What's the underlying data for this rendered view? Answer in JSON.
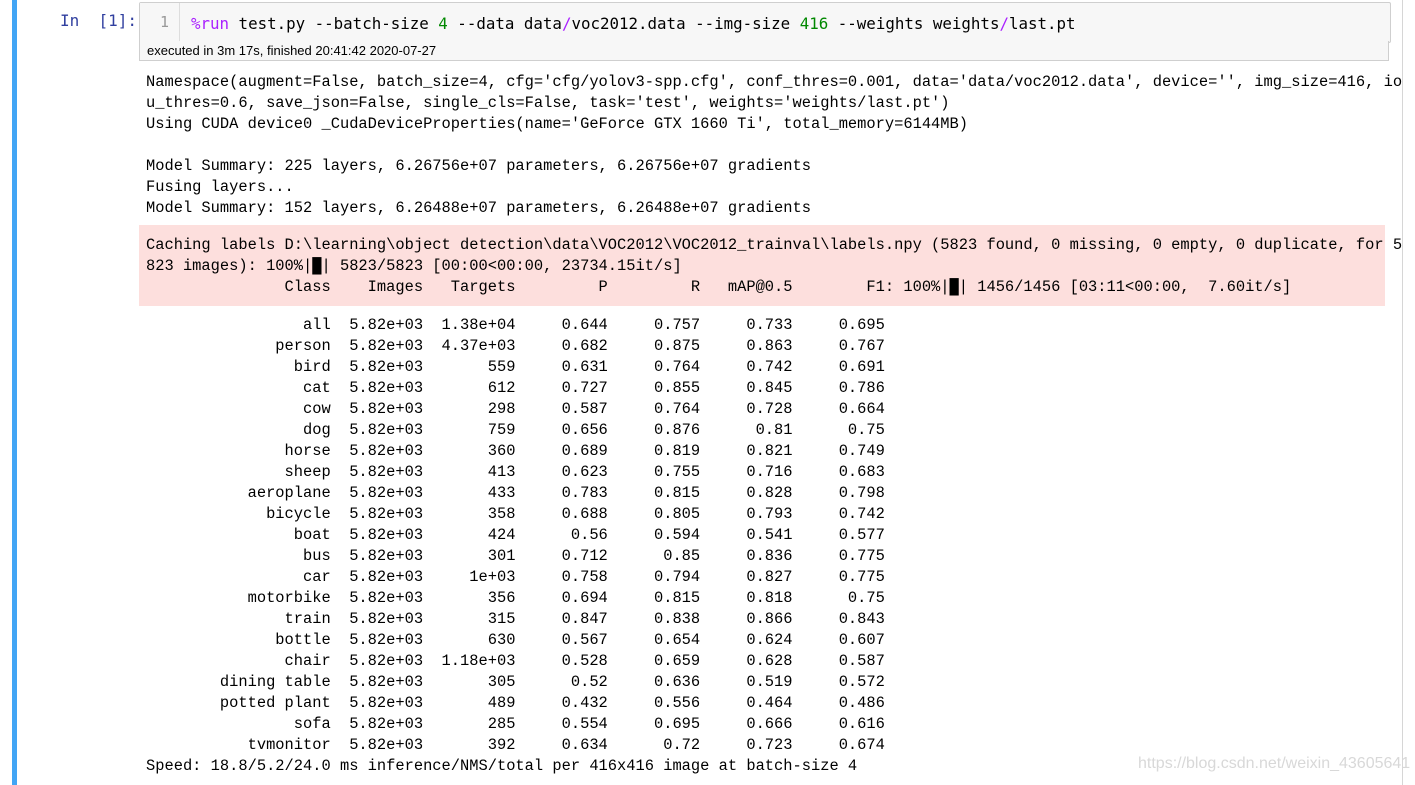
{
  "cell": {
    "prompt": "In  [1]:",
    "line_number": "1",
    "code": {
      "magic": "%run",
      "part1": " test.py --batch-size ",
      "batch": "4",
      "part2": " --data data",
      "slash1": "/",
      "part3": "voc2012.data --img-size ",
      "img": "416",
      "part4": " --weights weights",
      "slash2": "/",
      "part5": "last.pt"
    },
    "execution_info": "executed in 3m 17s, finished 20:41:42 2020-07-27"
  },
  "output": {
    "stdout_top": "Namespace(augment=False, batch_size=4, cfg='cfg/yolov3-spp.cfg', conf_thres=0.001, data='data/voc2012.data', device='', img_size=416, io\nu_thres=0.6, save_json=False, single_cls=False, task='test', weights='weights/last.pt')\nUsing CUDA device0 _CudaDeviceProperties(name='GeForce GTX 1660 Ti', total_memory=6144MB)\n\nModel Summary: 225 layers, 6.26756e+07 parameters, 6.26756e+07 gradients\nFusing layers...\nModel Summary: 152 layers, 6.26488e+07 parameters, 6.26488e+07 gradients",
    "stderr": "Caching labels D:\\learning\\object detection\\data\\VOC2012\\VOC2012_trainval\\labels.npy (5823 found, 0 missing, 0 empty, 0 duplicate, for 5\n823 images): 100%|█| 5823/5823 [00:00<00:00, 23734.15it/s]\n               Class    Images   Targets         P         R   mAP@0.5        F1: 100%|█| 1456/1456 [03:11<00:00,  7.60it/s]",
    "results_table": "                 all  5.82e+03  1.38e+04     0.644     0.757     0.733     0.695\n              person  5.82e+03  4.37e+03     0.682     0.875     0.863     0.767\n                bird  5.82e+03       559     0.631     0.764     0.742     0.691\n                 cat  5.82e+03       612     0.727     0.855     0.845     0.786\n                 cow  5.82e+03       298     0.587     0.764     0.728     0.664\n                 dog  5.82e+03       759     0.656     0.876      0.81      0.75\n               horse  5.82e+03       360     0.689     0.819     0.821     0.749\n               sheep  5.82e+03       413     0.623     0.755     0.716     0.683\n           aeroplane  5.82e+03       433     0.783     0.815     0.828     0.798\n             bicycle  5.82e+03       358     0.688     0.805     0.793     0.742\n                boat  5.82e+03       424      0.56     0.594     0.541     0.577\n                 bus  5.82e+03       301     0.712      0.85     0.836     0.775\n                 car  5.82e+03     1e+03     0.758     0.794     0.827     0.775\n           motorbike  5.82e+03       356     0.694     0.815     0.818      0.75\n               train  5.82e+03       315     0.847     0.838     0.866     0.843\n              bottle  5.82e+03       630     0.567     0.654     0.624     0.607\n               chair  5.82e+03  1.18e+03     0.528     0.659     0.628     0.587\n        dining table  5.82e+03       305      0.52     0.636     0.519     0.572\n        potted plant  5.82e+03       489     0.432     0.556     0.464     0.486\n                sofa  5.82e+03       285     0.554     0.695     0.666     0.616\n           tvmonitor  5.82e+03       392     0.634      0.72     0.723     0.674",
    "speed": "Speed: 18.8/5.2/24.0 ms inference/NMS/total per 416x416 image at batch-size 4"
  },
  "watermark": "https://blog.csdn.net/weixin_43605641",
  "colors": {
    "cell_border": "#42a5f5",
    "prompt": "#303f9f",
    "stderr_background": "#fddfdd",
    "code_magic": "#aa22ff",
    "code_number": "#008800"
  }
}
